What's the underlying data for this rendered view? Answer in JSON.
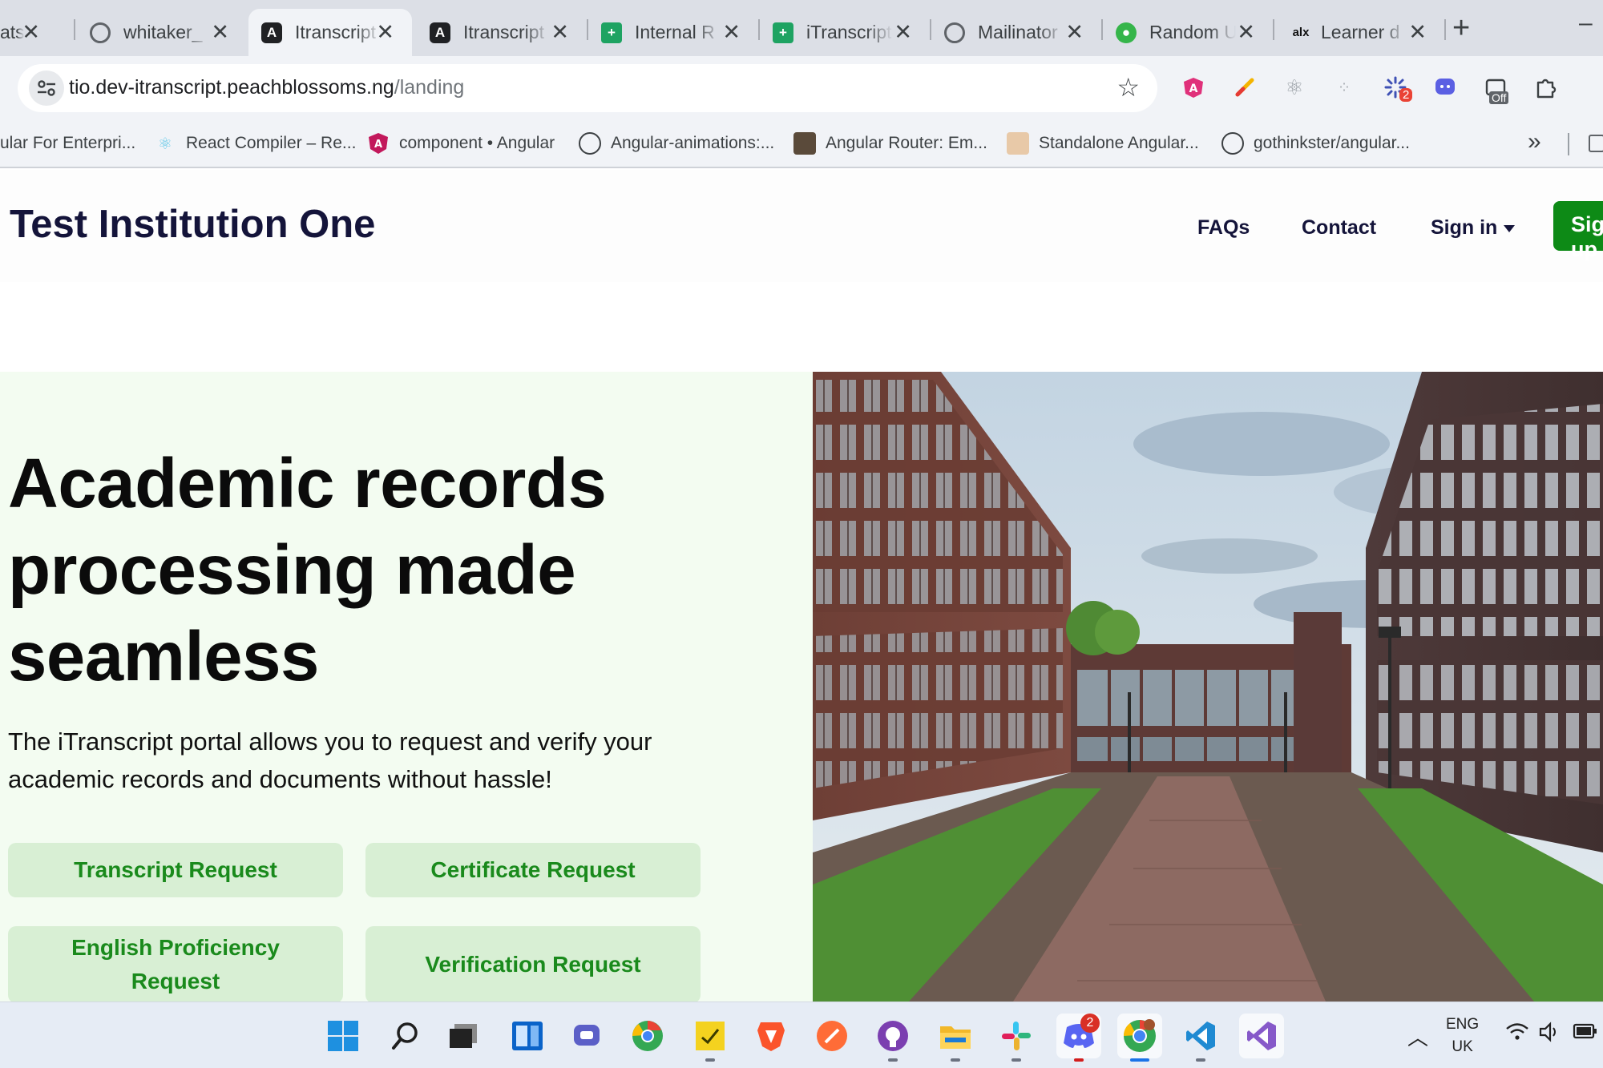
{
  "browser": {
    "tabs": [
      {
        "title": "ats",
        "icon": "none"
      },
      {
        "title": "whitaker_",
        "icon": "globe-icon"
      },
      {
        "title": "Itranscript",
        "icon": "angular-icon",
        "active": true
      },
      {
        "title": "Itranscript",
        "icon": "angular-icon"
      },
      {
        "title": "Internal R",
        "icon": "sheets-icon"
      },
      {
        "title": "iTranscript",
        "icon": "sheets-icon"
      },
      {
        "title": "Mailinator",
        "icon": "globe-icon"
      },
      {
        "title": "Random U",
        "icon": "green-circle-icon"
      },
      {
        "title": "Learner d",
        "icon": "alx-icon"
      }
    ],
    "alx_logo_text": "alx",
    "url_host": "tio.dev-itranscript.peachblossoms.ng",
    "url_path": "/landing",
    "extension_badge": "2",
    "extension_off_label": "Off",
    "bookmarks": [
      {
        "label": "ular For Enterpri...",
        "icon": "none"
      },
      {
        "label": "React Compiler – Re...",
        "icon": "react-icon"
      },
      {
        "label": "component • Angular",
        "icon": "angular-icon"
      },
      {
        "label": "Angular-animations:...",
        "icon": "github-icon"
      },
      {
        "label": "Angular Router: Em...",
        "icon": "avatar-icon"
      },
      {
        "label": "Standalone Angular...",
        "icon": "avatar-icon"
      },
      {
        "label": "gothinkster/angular...",
        "icon": "github-icon"
      }
    ]
  },
  "header": {
    "brand": "Test Institution One",
    "nav": {
      "faqs": "FAQs",
      "contact": "Contact",
      "signin": "Sign in",
      "signup": "Sign up"
    }
  },
  "hero": {
    "title": "Academic records processing made seamless",
    "subtitle": "The iTranscript portal allows you to request and verify your academic records and documents without hassle!",
    "buttons": {
      "transcript": "Transcript Request",
      "certificate": "Certificate Request",
      "english": "English Proficiency Request",
      "verification": "Verification Request"
    }
  },
  "taskbar": {
    "discord_badge": "2",
    "lang_top": "ENG",
    "lang_bottom": "UK"
  },
  "colors": {
    "brand_green": "#0d8a16",
    "cta_bg": "#d8efd4",
    "cta_text": "#1a8a1c",
    "hero_bg": "#f3fcf1"
  }
}
